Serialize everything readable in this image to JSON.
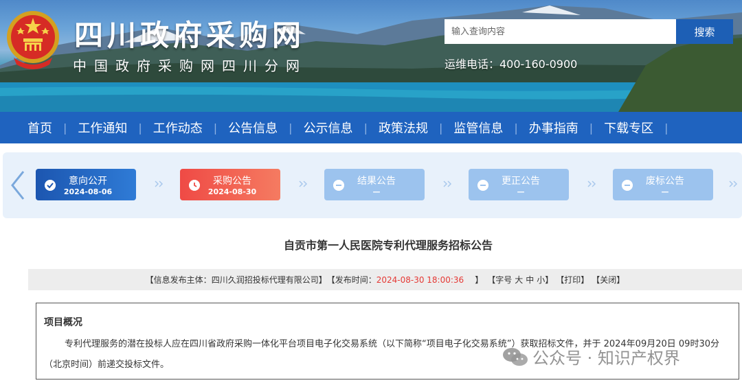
{
  "header": {
    "site_title": "四川政府采购网",
    "site_subtitle": "中国政府采购网四川分网",
    "search_placeholder": "输入查询内容",
    "search_button": "搜索",
    "hotline": "运维电话：400-160-0900"
  },
  "nav": {
    "items": [
      {
        "label": "首页"
      },
      {
        "label": "工作通知"
      },
      {
        "label": "工作动态"
      },
      {
        "label": "公告信息"
      },
      {
        "label": "公示信息"
      },
      {
        "label": "政策法规"
      },
      {
        "label": "监管信息"
      },
      {
        "label": "办事指南"
      },
      {
        "label": "下载专区"
      }
    ],
    "separator": "|"
  },
  "progress": {
    "steps": [
      {
        "label": "意向公开",
        "date": "2024-08-06",
        "status": "done",
        "icon": "check-icon"
      },
      {
        "label": "采购公告",
        "date": "2024-08-30",
        "status": "active",
        "icon": "clock-icon"
      },
      {
        "label": "结果公告",
        "date": "—",
        "status": "pending",
        "icon": "minus-icon"
      },
      {
        "label": "更正公告",
        "date": "—",
        "status": "pending",
        "icon": "minus-icon"
      },
      {
        "label": "废标公告",
        "date": "—",
        "status": "pending",
        "icon": "minus-icon"
      }
    ]
  },
  "article": {
    "title": "自贡市第一人民医院专利代理服务招标公告",
    "meta": {
      "publisher_label": "【信息发布主体：",
      "publisher": "四川久润招投标代理有限公司",
      "publisher_close": "】",
      "time_label": "【发布时间：",
      "time": "2024-08-30 18:00:36",
      "time_close": "】",
      "font_size_label": "【字号",
      "size_large": "大",
      "size_medium": "中",
      "size_small": "小",
      "font_size_close": "】",
      "print": "【打印】",
      "close": "【关闭】"
    },
    "section_title": "项目概况",
    "paragraph": "专利代理服务的潜在投标人应在四川省政府采购一体化平台项目电子化交易系统（以下简称“项目电子化交易系统”）获取招标文件，并于 2024年09月20日  09时30分 （北京时间）前递交投标文件。"
  },
  "watermark": {
    "text": "公众号 · 知识产权界"
  },
  "colors": {
    "nav_bg": "#1f63bf",
    "step_done": "#1c56b0",
    "step_active": "#ef4a45",
    "step_pending": "#9cc3ee",
    "highlight_red": "#e53935"
  }
}
